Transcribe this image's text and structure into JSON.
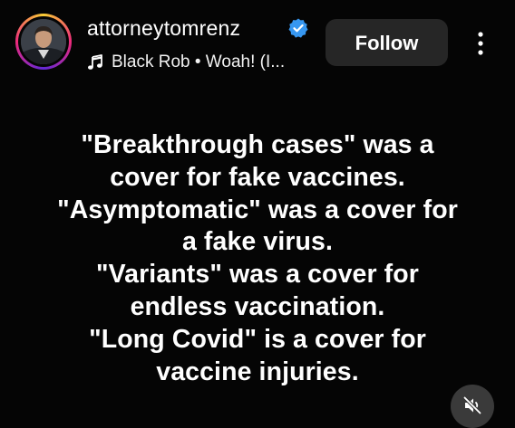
{
  "header": {
    "username": "attorneytomrenz",
    "audio_label": "Black Rob • Woah! (I...",
    "follow_label": "Follow",
    "verified_icon": "verified-badge-icon",
    "more_icon": "more-vertical-icon"
  },
  "post": {
    "lines": [
      "\"Breakthrough cases\" was a",
      "cover for fake vaccines.",
      "\"Asymptomatic\" was a cover for",
      "a fake virus.",
      "\"Variants\" was a cover for",
      "endless vaccination.",
      "\"Long Covid\" is a cover for",
      "vaccine injuries."
    ]
  },
  "controls": {
    "mute_icon": "speaker-muted-icon"
  },
  "colors": {
    "background": "#050505",
    "button_bg": "#262626",
    "verified_blue": "#3797f0",
    "text": "#ffffff"
  }
}
